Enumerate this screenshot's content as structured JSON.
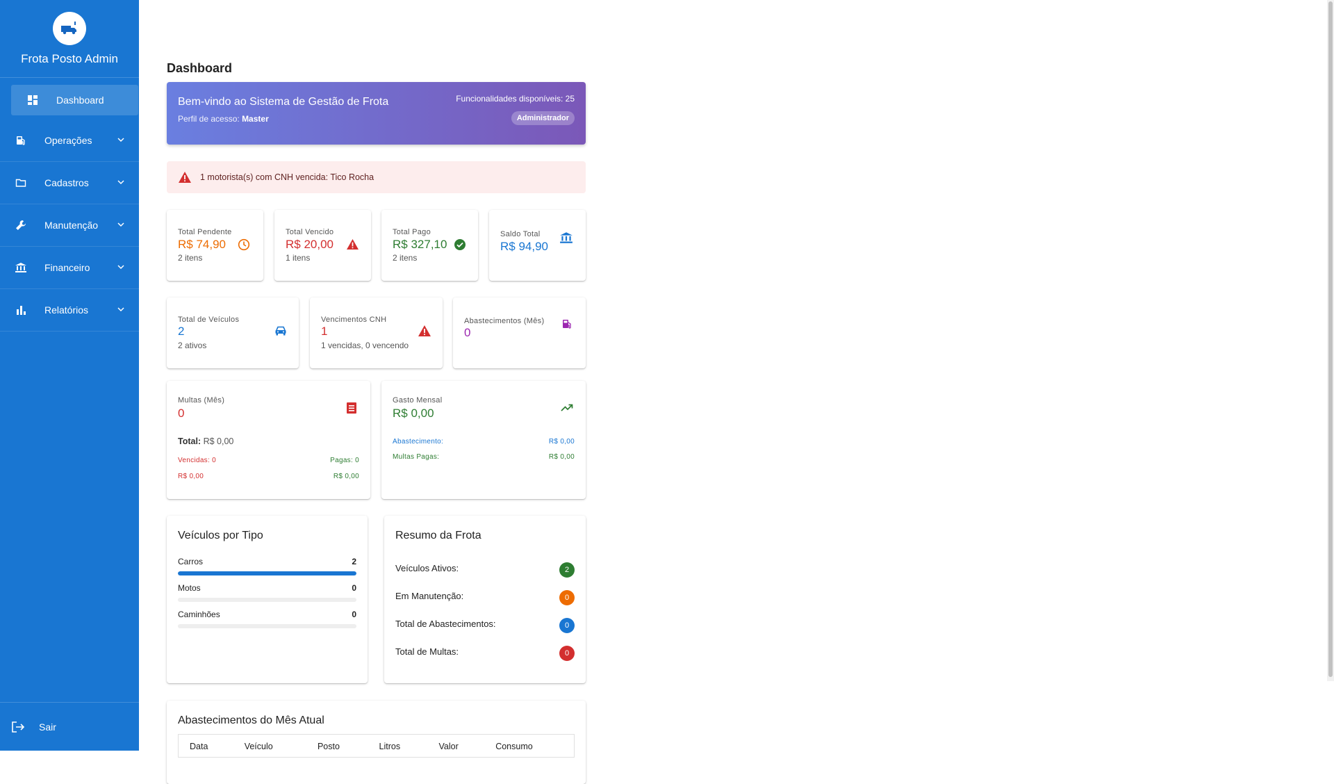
{
  "app": {
    "title": "Frota Posto Admin"
  },
  "sidebar": {
    "items": [
      {
        "label": "Dashboard",
        "icon": "dashboard-icon"
      },
      {
        "label": "Operações",
        "icon": "fuel-pump-icon"
      },
      {
        "label": "Cadastros",
        "icon": "folder-icon"
      },
      {
        "label": "Manutenção",
        "icon": "wrench-icon"
      },
      {
        "label": "Financeiro",
        "icon": "bank-icon"
      },
      {
        "label": "Relatórios",
        "icon": "bar-chart-icon"
      }
    ],
    "logout_label": "Sair"
  },
  "page": {
    "title": "Dashboard"
  },
  "welcome": {
    "title": "Bem-vindo ao Sistema de Gestão de Frota",
    "profile_prefix": "Perfil de acesso:",
    "profile_value": "Master",
    "features": "Funcionalidades disponíveis: 25",
    "role_badge": "Administrador"
  },
  "alert": {
    "text": "1 motorista(s) com CNH vencida: Tico Rocha"
  },
  "finance": {
    "pendente": {
      "label": "Total Pendente",
      "value": "R$ 74,90",
      "sub": "2 itens"
    },
    "vencido": {
      "label": "Total Vencido",
      "value": "R$ 20,00",
      "sub": "1 itens"
    },
    "pago": {
      "label": "Total Pago",
      "value": "R$ 327,10",
      "sub": "2 itens"
    },
    "saldo": {
      "label": "Saldo Total",
      "value": "R$ 94,90"
    }
  },
  "stats": {
    "veiculos": {
      "label": "Total de Veículos",
      "value": "2",
      "sub": "2 ativos"
    },
    "cnh": {
      "label": "Vencimentos CNH",
      "value": "1",
      "sub": "1 vencidas, 0 vencendo"
    },
    "abastecimentos": {
      "label": "Abastecimentos (Mês)",
      "value": "0"
    }
  },
  "multas": {
    "label": "Multas (Mês)",
    "value": "0",
    "total_label": "Total:",
    "total_value": "R$ 0,00",
    "vencidas_label": "Vencidas: 0",
    "pagas_label": "Pagas: 0",
    "vencidas_value": "R$ 0,00",
    "pagas_value": "R$ 0,00"
  },
  "gasto": {
    "label": "Gasto Mensal",
    "value": "R$ 0,00",
    "abastecimento_label": "Abastecimento:",
    "abastecimento_value": "R$ 0,00",
    "multas_label": "Multas Pagas:",
    "multas_value": "R$ 0,00"
  },
  "veiculos_tipo": {
    "title": "Veículos por Tipo",
    "rows": [
      {
        "label": "Carros",
        "count": "2",
        "fraction": 1.0
      },
      {
        "label": "Motos",
        "count": "0",
        "fraction": 0
      },
      {
        "label": "Caminhões",
        "count": "0",
        "fraction": 0
      }
    ]
  },
  "resumo": {
    "title": "Resumo da Frota",
    "rows": [
      {
        "label": "Veículos Ativos:",
        "value": "2",
        "color": "#2e7d32"
      },
      {
        "label": "Em Manutenção:",
        "value": "0",
        "color": "#ed6c02"
      },
      {
        "label": "Total de Abastecimentos:",
        "value": "0",
        "color": "#1976d2"
      },
      {
        "label": "Total de Multas:",
        "value": "0",
        "color": "#d32f2f"
      }
    ]
  },
  "abastecimentos_mes": {
    "title": "Abastecimentos do Mês Atual",
    "columns": [
      "Data",
      "Veículo",
      "Posto",
      "Litros",
      "Valor",
      "Consumo"
    ]
  }
}
